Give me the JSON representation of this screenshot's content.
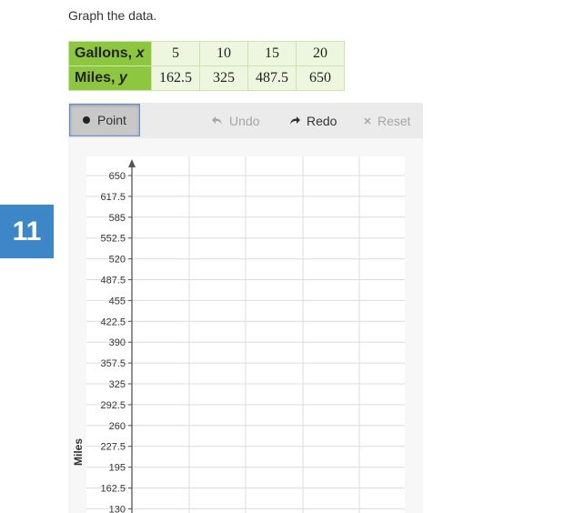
{
  "question": {
    "number": "11",
    "prompt": "Graph the data."
  },
  "table": {
    "row1": {
      "label": "Gallons, ",
      "var": "x",
      "values": [
        "5",
        "10",
        "15",
        "20"
      ]
    },
    "row2": {
      "label": "Miles, ",
      "var": "y",
      "values": [
        "162.5",
        "325",
        "487.5",
        "650"
      ]
    }
  },
  "toolbar": {
    "point_label": "Point",
    "undo_label": "Undo",
    "redo_label": "Redo",
    "reset_label": "Reset"
  },
  "colors": {
    "question_badge": "#3d87c8",
    "table_header": "#8dc63f",
    "table_cell": "#eef6df",
    "toolbar_bg": "#ebebeb",
    "active_border": "#5b8fd6"
  },
  "chart_data": {
    "type": "scatter",
    "ylabel": "Miles",
    "y_ticks": [
      "650",
      "617.5",
      "585",
      "552.5",
      "520",
      "487.5",
      "455",
      "422.5",
      "390",
      "357.5",
      "325",
      "292.5",
      "260",
      "227.5",
      "195",
      "162.5",
      "130"
    ],
    "ylim": [
      130,
      650
    ],
    "points": []
  }
}
